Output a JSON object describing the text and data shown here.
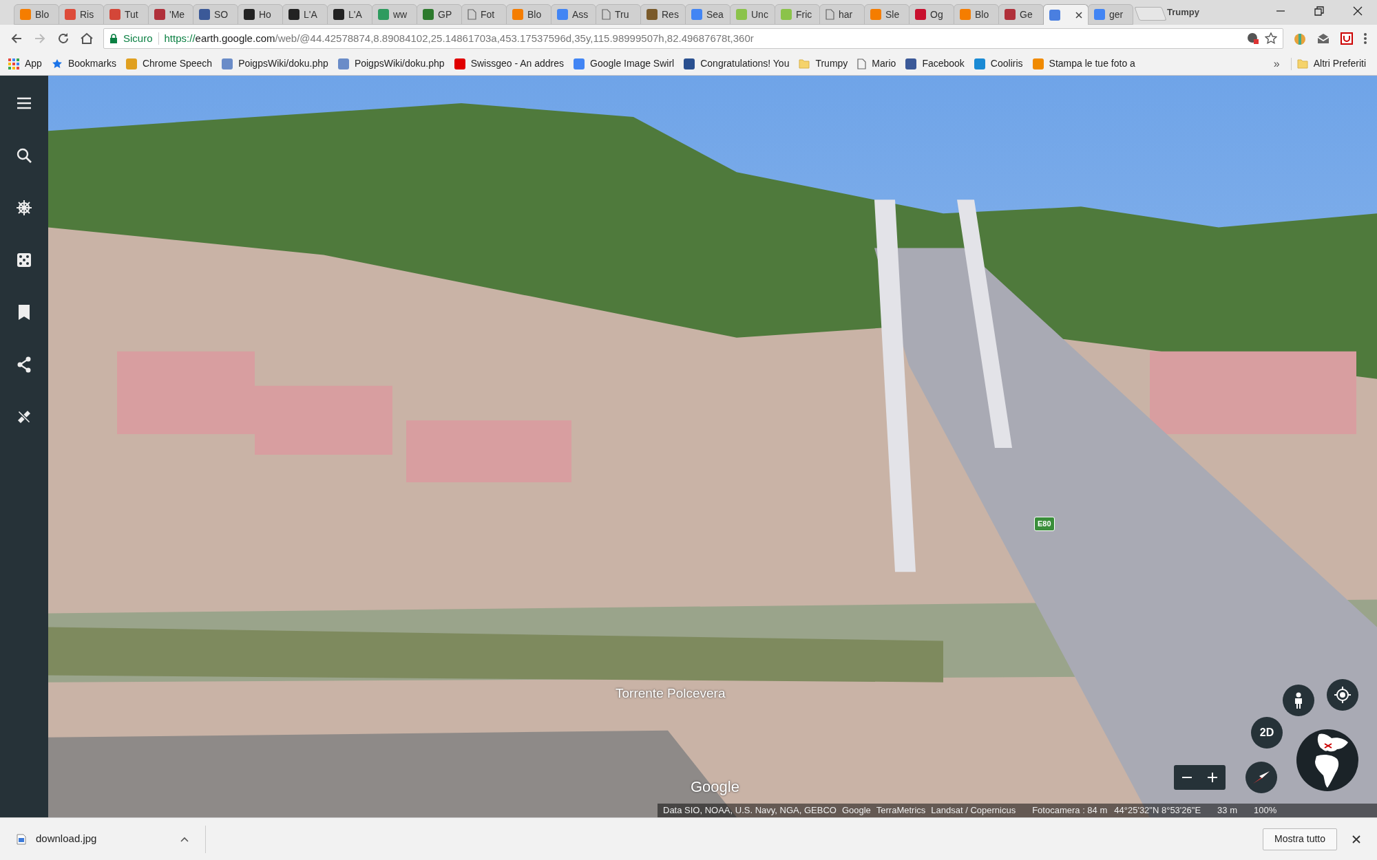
{
  "browser": {
    "tabs": [
      {
        "label": "Blo",
        "kind": "favicon",
        "color": "#f57d00",
        "selected": false
      },
      {
        "label": "Ris",
        "kind": "favicon",
        "color": "#dd4b39",
        "selected": false
      },
      {
        "label": "Tut",
        "kind": "favicon",
        "color": "#d44638",
        "selected": false
      },
      {
        "label": "'Me",
        "kind": "favicon",
        "color": "#b0303a",
        "selected": false
      },
      {
        "label": "SO",
        "kind": "favicon",
        "color": "#3b5998",
        "selected": false
      },
      {
        "label": "Ho",
        "kind": "favicon",
        "color": "#222222",
        "selected": false
      },
      {
        "label": "L'A",
        "kind": "favicon",
        "color": "#222222",
        "selected": false
      },
      {
        "label": "L'A",
        "kind": "favicon",
        "color": "#222222",
        "selected": false
      },
      {
        "label": "ww",
        "kind": "favicon",
        "color": "#2e9b5f",
        "selected": false
      },
      {
        "label": "GP",
        "kind": "favicon",
        "color": "#2d7a2d",
        "selected": false
      },
      {
        "label": "Fot",
        "kind": "page",
        "selected": false
      },
      {
        "label": "Blo",
        "kind": "favicon",
        "color": "#f57d00",
        "selected": false
      },
      {
        "label": "Ass",
        "kind": "favicon",
        "color": "#4285f4",
        "selected": false
      },
      {
        "label": "Tru",
        "kind": "page",
        "selected": false
      },
      {
        "label": "Res",
        "kind": "favicon",
        "color": "#7a5a2a",
        "selected": false
      },
      {
        "label": "Sea",
        "kind": "favicon",
        "color": "#4285f4",
        "selected": false
      },
      {
        "label": "Unc",
        "kind": "favicon",
        "color": "#8bc34a",
        "selected": false
      },
      {
        "label": "Fric",
        "kind": "favicon",
        "color": "#8bc34a",
        "selected": false
      },
      {
        "label": "har",
        "kind": "page",
        "selected": false
      },
      {
        "label": "Sle",
        "kind": "favicon",
        "color": "#f57d00",
        "selected": false
      },
      {
        "label": "Og",
        "kind": "favicon",
        "color": "#c8102e",
        "selected": false
      },
      {
        "label": "Blo",
        "kind": "favicon",
        "color": "#f57d00",
        "selected": false
      },
      {
        "label": "Ge",
        "kind": "favicon",
        "color": "#b0303a",
        "selected": false
      },
      {
        "kind": "favicon",
        "color": "#4a7fe0",
        "selected": true
      },
      {
        "label": "ger",
        "kind": "favicon",
        "color": "#4285f4",
        "selected": false
      }
    ],
    "profile": "Trumpy",
    "address_bar": {
      "security_label": "Sicuro",
      "url_scheme": "https://",
      "url_host": "earth.google.com",
      "url_path": "/web/@44.42578874,8.89084102,25.14861703a,453.17537596d,35y,115.98999507h,82.49687678t,360r"
    },
    "bookmarks": [
      {
        "label": "App",
        "kind": "apps"
      },
      {
        "label": "Bookmarks",
        "kind": "star"
      },
      {
        "label": "Chrome Speech",
        "kind": "favicon",
        "color": "#e0a020"
      },
      {
        "label": "PoigpsWiki/doku.php",
        "kind": "favicon",
        "color": "#6a8cc8"
      },
      {
        "label": "PoigpsWiki/doku.php",
        "kind": "favicon",
        "color": "#6a8cc8"
      },
      {
        "label": "Swissgeo - An addres",
        "kind": "favicon",
        "color": "#e00000"
      },
      {
        "label": "Google Image Swirl",
        "kind": "favicon",
        "color": "#4285f4"
      },
      {
        "label": "Congratulations! You",
        "kind": "favicon",
        "color": "#2a5090"
      },
      {
        "label": "Trumpy",
        "kind": "folder"
      },
      {
        "label": "Mario",
        "kind": "page"
      },
      {
        "label": "Facebook",
        "kind": "favicon",
        "color": "#3b5998"
      },
      {
        "label": "Cooliris",
        "kind": "favicon",
        "color": "#1a8ad4"
      },
      {
        "label": "Stampa le tue foto a",
        "kind": "favicon",
        "color": "#f08a00"
      }
    ],
    "bookmarks_overflow": "»",
    "other_bookmarks": "Altri Preferiti"
  },
  "earth": {
    "map_labels": [
      {
        "kind": "place",
        "text": "Torrente Polcevera"
      },
      {
        "kind": "road_shield",
        "text": "E80"
      }
    ],
    "logo": "Google",
    "view_mode_button": "2D",
    "attribution": [
      "Data SIO, NOAA, U.S. Navy, NGA, GEBCO",
      "Google",
      "TerraMetrics",
      "Landsat / Copernicus"
    ],
    "camera": "Fotocamera :  84 m",
    "coordinates": "44°25'32\"N 8°53'26\"E",
    "scale": "33 m",
    "zoom_percent": "100%"
  },
  "downloads": {
    "file": "download.jpg",
    "show_all": "Mostra tutto"
  }
}
